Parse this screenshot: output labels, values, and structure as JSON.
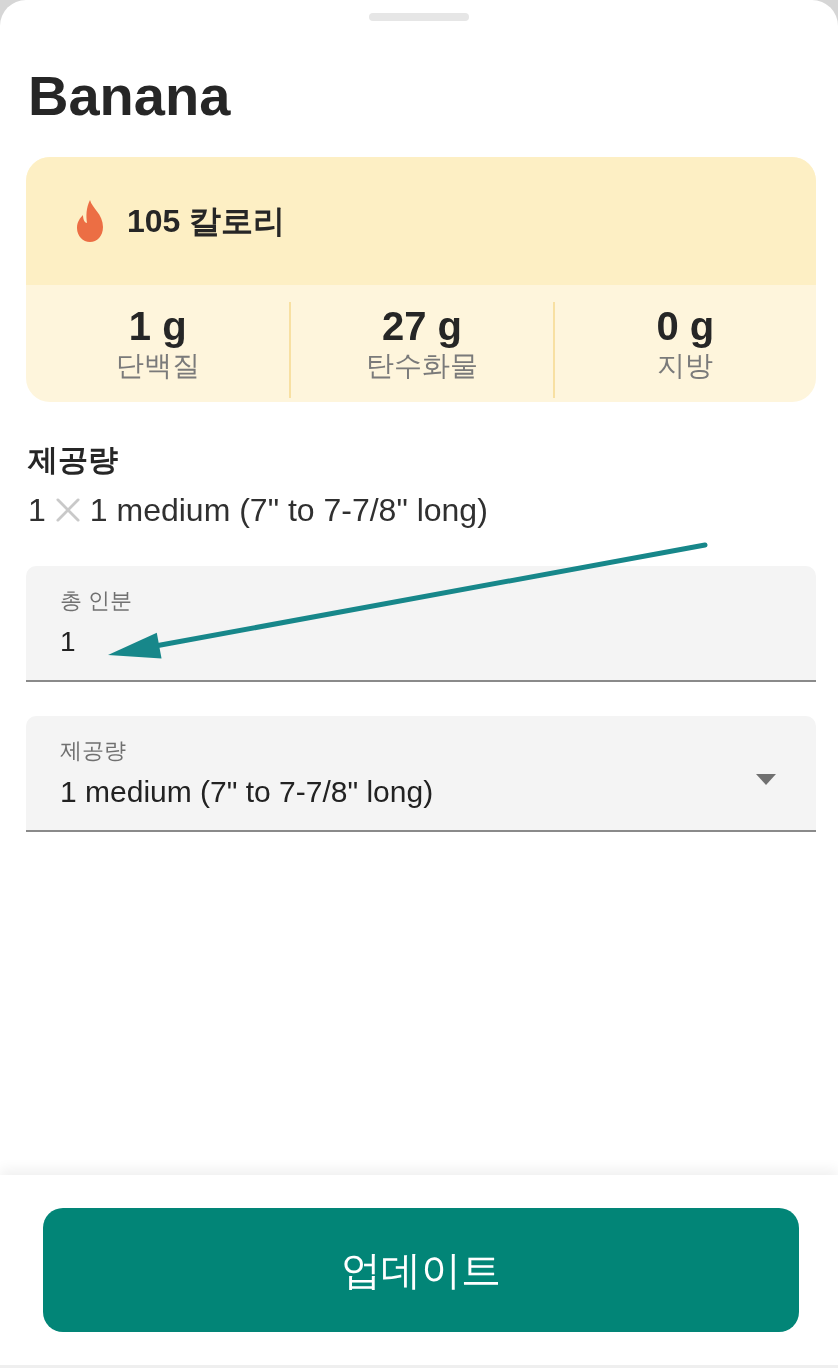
{
  "sheet": {
    "title": "Banana"
  },
  "nutrition": {
    "calories": "105 칼로리",
    "macros": [
      {
        "value": "1 g",
        "label": "단백질"
      },
      {
        "value": "27 g",
        "label": "탄수화물"
      },
      {
        "value": "0 g",
        "label": "지방"
      }
    ]
  },
  "serving": {
    "heading": "제공량",
    "quantity": "1",
    "unit": "1 medium (7\" to 7-7/8\" long)"
  },
  "fields": [
    {
      "kind": "text",
      "label": "총 인분",
      "value": "1"
    },
    {
      "kind": "select",
      "label": "제공량",
      "value": "1 medium (7\" to 7-7/8\" long)"
    }
  ],
  "footer": {
    "button": "업데이트"
  }
}
